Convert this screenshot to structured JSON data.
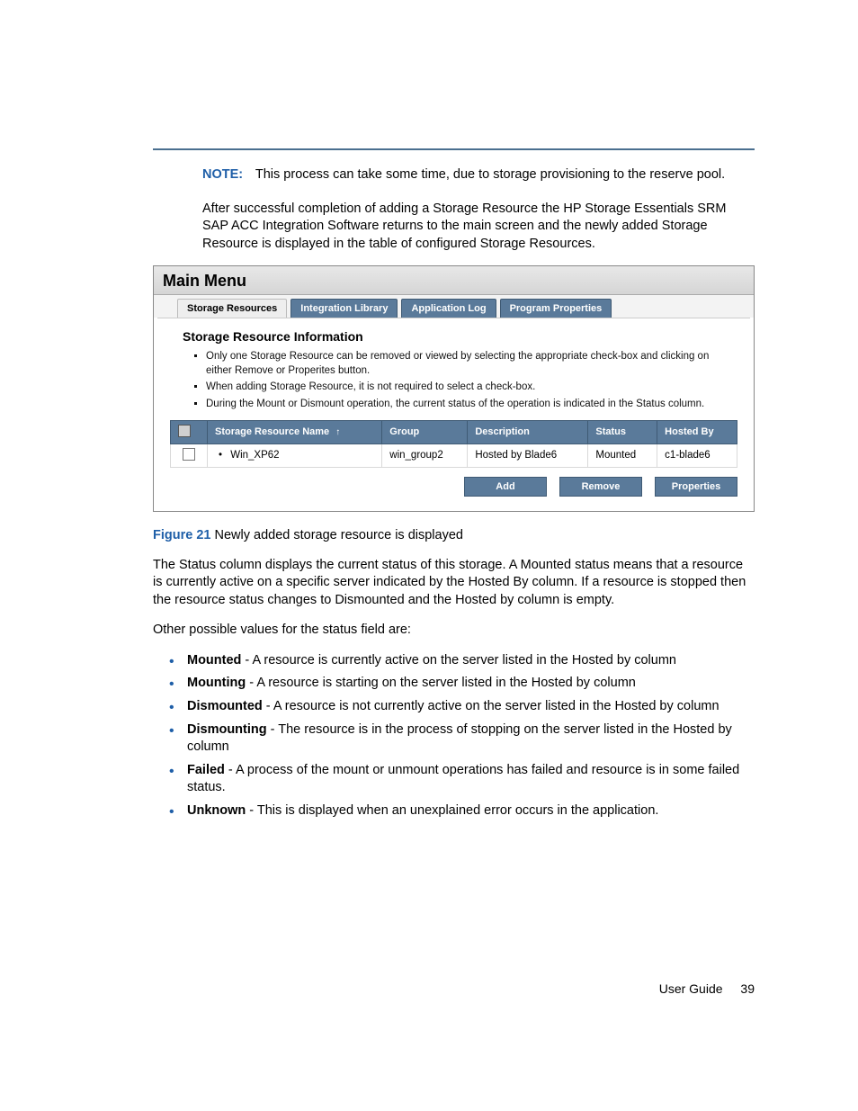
{
  "note": {
    "label": "NOTE:",
    "text": "This process can take some time, due to storage provisioning to the reserve pool."
  },
  "intro_paragraph": "After successful completion of adding a Storage Resource the HP Storage Essentials SRM SAP ACC Integration Software returns to the main screen and the newly added Storage Resource is displayed in the table of configured Storage Resources.",
  "screenshot": {
    "title": "Main Menu",
    "tabs": [
      {
        "label": "Storage Resources",
        "active": true
      },
      {
        "label": "Integration Library",
        "active": false
      },
      {
        "label": "Application Log",
        "active": false
      },
      {
        "label": "Program Properties",
        "active": false
      }
    ],
    "panel_heading": "Storage Resource Information",
    "info_bullets": [
      "Only one Storage Resource can be removed or viewed by selecting the appropriate check-box and clicking on either Remove or Properites button.",
      "When adding Storage Resource, it is not required to select a check-box.",
      "During the Mount or Dismount operation, the current status of the operation is indicated in the Status column."
    ],
    "columns": [
      "Storage Resource Name",
      "Group",
      "Description",
      "Status",
      "Hosted By"
    ],
    "rows": [
      {
        "name": "Win_XP62",
        "group": "win_group2",
        "description": "Hosted by Blade6",
        "status": "Mounted",
        "hosted_by": "c1-blade6"
      }
    ],
    "buttons": [
      "Add",
      "Remove",
      "Properties"
    ]
  },
  "figure": {
    "label": "Figure 21",
    "caption": "Newly added storage resource is displayed"
  },
  "para_status_intro": "The Status column displays the current status of this storage. A Mounted status means that a resource is currently active on a specific server indicated by the Hosted By column. If a resource is stopped then the resource status changes to Dismounted and the Hosted by column is empty.",
  "para_other_values": "Other possible values for the status field are:",
  "status_list": [
    {
      "name": "Mounted",
      "desc": " - A resource is currently active on the server listed in the Hosted by column"
    },
    {
      "name": "Mounting",
      "desc": " - A resource is starting on the server listed in the Hosted by column"
    },
    {
      "name": "Dismounted",
      "desc": " - A resource is not currently active on the server listed in the Hosted by column"
    },
    {
      "name": "Dismounting",
      "desc": " - The resource is in the process of stopping on the server listed in the Hosted by column"
    },
    {
      "name": "Failed",
      "desc": " - A process of the mount or unmount operations has failed and resource is in some failed status."
    },
    {
      "name": "Unknown",
      "desc": " - This is displayed when an unexplained error occurs in the application."
    }
  ],
  "footer": {
    "doc": "User Guide",
    "page": "39"
  }
}
